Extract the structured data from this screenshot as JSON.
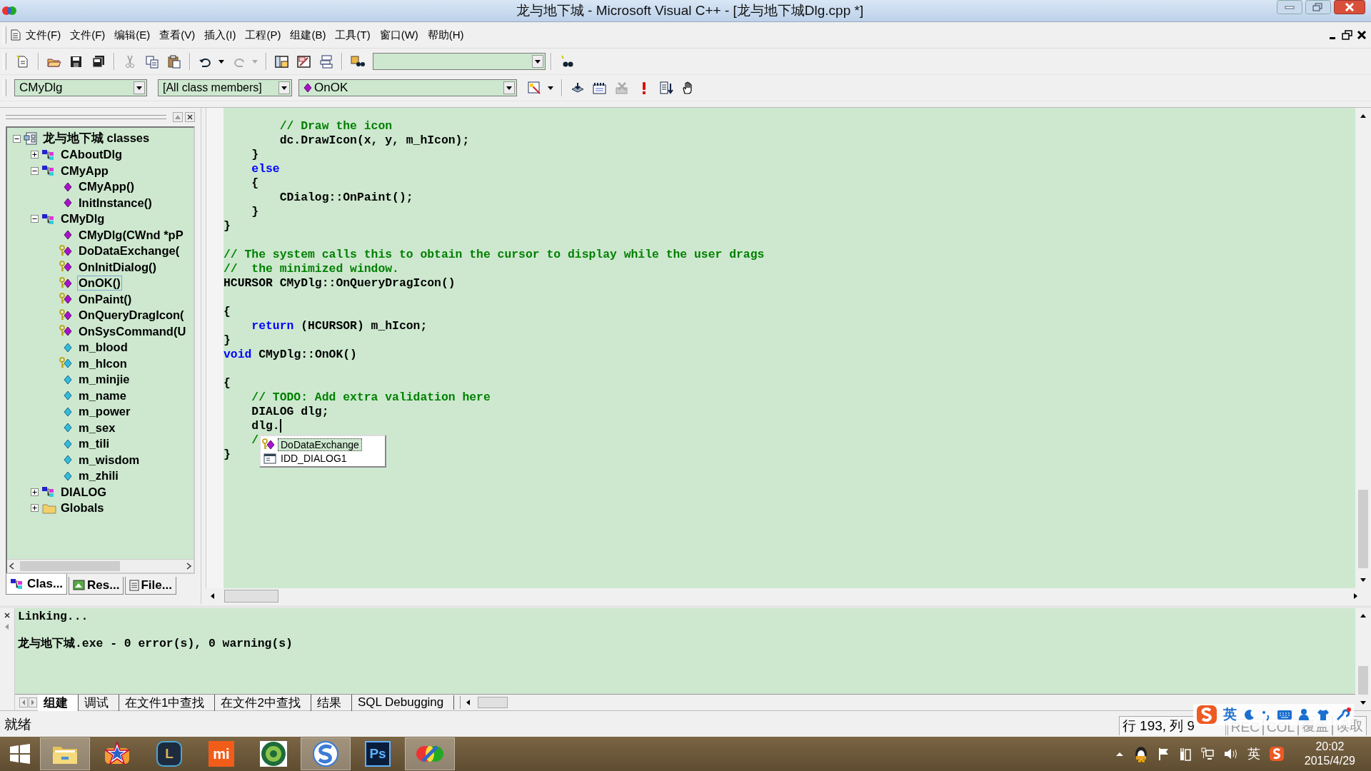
{
  "window": {
    "title": "龙与地下城 - Microsoft Visual C++ - [龙与地下城Dlg.cpp *]"
  },
  "menu": [
    "文件(F)",
    "文件(F)",
    "编辑(E)",
    "查看(V)",
    "插入(I)",
    "工程(P)",
    "组建(B)",
    "工具(T)",
    "窗口(W)",
    "帮助(H)"
  ],
  "class_bar": {
    "class": "CMyDlg",
    "filter": "[All class members]",
    "member": "OnOK"
  },
  "workspace": {
    "tree": [
      {
        "label": "龙与地下城 classes",
        "kind": "project",
        "expanded": true,
        "selected": false,
        "children": [
          {
            "label": "CAboutDlg",
            "kind": "class",
            "expanded": false,
            "selected": false
          },
          {
            "label": "CMyApp",
            "kind": "class",
            "expanded": true,
            "selected": false,
            "children": [
              {
                "label": "CMyApp()",
                "kind": "method",
                "selected": false
              },
              {
                "label": "InitInstance()",
                "kind": "method",
                "selected": false
              }
            ]
          },
          {
            "label": "CMyDlg",
            "kind": "class",
            "expanded": true,
            "selected": false,
            "children": [
              {
                "label": "CMyDlg(CWnd *pP",
                "kind": "method",
                "selected": false
              },
              {
                "label": "DoDataExchange(",
                "kind": "protected-method",
                "selected": false
              },
              {
                "label": "OnInitDialog()",
                "kind": "protected-method",
                "selected": false
              },
              {
                "label": "OnOK()",
                "kind": "protected-method",
                "selected": true
              },
              {
                "label": "OnPaint()",
                "kind": "protected-method",
                "selected": false
              },
              {
                "label": "OnQueryDragIcon(",
                "kind": "protected-method",
                "selected": false
              },
              {
                "label": "OnSysCommand(U",
                "kind": "protected-method",
                "selected": false
              },
              {
                "label": "m_blood",
                "kind": "member",
                "selected": false
              },
              {
                "label": "m_hIcon",
                "kind": "protected-member",
                "selected": false
              },
              {
                "label": "m_minjie",
                "kind": "member",
                "selected": false
              },
              {
                "label": "m_name",
                "kind": "member",
                "selected": false
              },
              {
                "label": "m_power",
                "kind": "member",
                "selected": false
              },
              {
                "label": "m_sex",
                "kind": "member",
                "selected": false
              },
              {
                "label": "m_tili",
                "kind": "member",
                "selected": false
              },
              {
                "label": "m_wisdom",
                "kind": "member",
                "selected": false
              },
              {
                "label": "m_zhili",
                "kind": "member",
                "selected": false
              }
            ]
          },
          {
            "label": "DIALOG",
            "kind": "class",
            "expanded": false,
            "selected": false
          },
          {
            "label": "Globals",
            "kind": "folder",
            "expanded": false,
            "selected": false
          }
        ]
      }
    ],
    "tabs": [
      {
        "label": "Clas...",
        "kind": "class",
        "selected": true
      },
      {
        "label": "Res...",
        "kind": "resource",
        "selected": false
      },
      {
        "label": "File...",
        "kind": "file",
        "selected": false
      }
    ]
  },
  "editor": {
    "lines": [
      {
        "kind": "code",
        "tokens": [
          {
            "kind": "comment",
            "text": "        // Draw the icon"
          }
        ]
      },
      {
        "kind": "code",
        "tokens": [
          {
            "kind": "plain",
            "text": "        dc.DrawIcon(x, y, m_hIcon);"
          }
        ]
      },
      {
        "kind": "code",
        "tokens": [
          {
            "kind": "plain",
            "text": "    }"
          }
        ]
      },
      {
        "kind": "code",
        "tokens": [
          {
            "kind": "keyword",
            "text": "    else"
          }
        ]
      },
      {
        "kind": "code",
        "tokens": [
          {
            "kind": "plain",
            "text": "    {"
          }
        ]
      },
      {
        "kind": "code",
        "tokens": [
          {
            "kind": "plain",
            "text": "        CDialog::OnPaint();"
          }
        ]
      },
      {
        "kind": "code",
        "tokens": [
          {
            "kind": "plain",
            "text": "    }"
          }
        ]
      },
      {
        "kind": "code",
        "tokens": [
          {
            "kind": "plain",
            "text": "}"
          }
        ]
      },
      {
        "kind": "blank"
      },
      {
        "kind": "code",
        "tokens": [
          {
            "kind": "comment",
            "text": "// The system calls this to obtain the cursor to display while the user drags"
          }
        ]
      },
      {
        "kind": "code",
        "tokens": [
          {
            "kind": "comment",
            "text": "//  the minimized window."
          }
        ]
      },
      {
        "kind": "code",
        "tokens": [
          {
            "kind": "plain",
            "text": "HCURSOR CMyDlg::OnQueryDragIcon()"
          }
        ]
      },
      {
        "kind": "blank"
      },
      {
        "kind": "code",
        "tokens": [
          {
            "kind": "plain",
            "text": "{"
          }
        ]
      },
      {
        "kind": "code",
        "tokens": [
          {
            "kind": "keyword",
            "text": "    return"
          },
          {
            "kind": "plain",
            "text": " (HCURSOR) m_hIcon;"
          }
        ]
      },
      {
        "kind": "code",
        "tokens": [
          {
            "kind": "plain",
            "text": "}"
          }
        ]
      },
      {
        "kind": "code",
        "tokens": [
          {
            "kind": "keyword",
            "text": "void"
          },
          {
            "kind": "plain",
            "text": " CMyDlg::OnOK()"
          }
        ]
      },
      {
        "kind": "blank"
      },
      {
        "kind": "code",
        "tokens": [
          {
            "kind": "plain",
            "text": "{"
          }
        ]
      },
      {
        "kind": "code",
        "tokens": [
          {
            "kind": "comment",
            "text": "    // TODO: Add extra validation here"
          }
        ]
      },
      {
        "kind": "code",
        "tokens": [
          {
            "kind": "plain",
            "text": "    DIALOG dlg;"
          }
        ]
      },
      {
        "kind": "code",
        "cursor": true,
        "tokens": [
          {
            "kind": "plain",
            "text": "    dlg."
          }
        ]
      },
      {
        "kind": "code",
        "tokens": [
          {
            "kind": "comment",
            "text": "    /"
          }
        ]
      },
      {
        "kind": "code",
        "tokens": [
          {
            "kind": "plain",
            "text": "}"
          }
        ]
      }
    ],
    "autocomplete": [
      {
        "label": "DoDataExchange",
        "kind": "protected-method",
        "selected": true
      },
      {
        "label": "IDD_DIALOG1",
        "kind": "resource",
        "selected": false
      }
    ]
  },
  "output": {
    "lines": [
      "Linking...",
      "龙与地下城.exe - 0 error(s), 0 warning(s)"
    ],
    "tabs": [
      {
        "label": "组建",
        "selected": true
      },
      {
        "label": "调试",
        "selected": false
      },
      {
        "label": "在文件1中查找",
        "selected": false
      },
      {
        "label": "在文件2中查找",
        "selected": false
      },
      {
        "label": "结果",
        "selected": false
      },
      {
        "label": "SQL Debugging",
        "selected": false
      }
    ]
  },
  "status_bar": {
    "text": "就绪",
    "position": "行 193, 列 9",
    "indicators": [
      {
        "label": "REC",
        "disabled": true
      },
      {
        "label": "COL",
        "disabled": true
      },
      {
        "label": "覆盖",
        "disabled": true
      },
      {
        "label": "读取",
        "disabled": true
      }
    ]
  },
  "ime_bar": {
    "language": "英"
  },
  "taskbar": {
    "apps": [
      {
        "kind": "folder",
        "running": true
      },
      {
        "kind": "star",
        "running": false
      },
      {
        "kind": "hexagon",
        "glyph": "L",
        "running": false
      },
      {
        "kind": "square",
        "glyph": "mi",
        "running": false
      },
      {
        "kind": "seal",
        "running": false
      },
      {
        "kind": "s-circle",
        "running": true
      },
      {
        "kind": "ps",
        "glyph": "Ps",
        "running": false
      },
      {
        "kind": "vc",
        "running": true
      }
    ],
    "tray": {
      "language": "英",
      "time": "20:02",
      "date": "2015/4/29"
    }
  }
}
